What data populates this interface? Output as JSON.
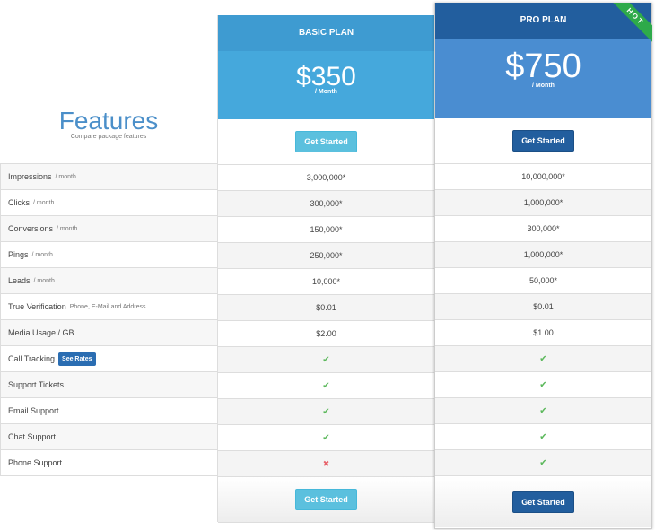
{
  "features_header": {
    "title": "Features",
    "subtitle": "Compare package features"
  },
  "features": [
    {
      "label": "Impressions",
      "sub": "/ month"
    },
    {
      "label": "Clicks",
      "sub": "/ month"
    },
    {
      "label": "Conversions",
      "sub": "/ month"
    },
    {
      "label": "Pings",
      "sub": "/ month"
    },
    {
      "label": "Leads",
      "sub": "/ month"
    },
    {
      "label": "True Verification",
      "sub": "Phone, E-Mail and Address"
    },
    {
      "label": "Media Usage / GB",
      "sub": ""
    },
    {
      "label": "Call Tracking",
      "sub": "",
      "badge": "See Rates"
    },
    {
      "label": "Support Tickets",
      "sub": ""
    },
    {
      "label": "Email Support",
      "sub": ""
    },
    {
      "label": "Chat Support",
      "sub": ""
    },
    {
      "label": "Phone Support",
      "sub": ""
    }
  ],
  "plans": {
    "basic": {
      "name": "BASIC PLAN",
      "price": "$350",
      "period": "/ Month",
      "cta_label": "Get Started",
      "accent": "#45a8dc",
      "values": [
        "3,000,000*",
        "300,000*",
        "150,000*",
        "250,000*",
        "10,000*",
        "$0.01",
        "$2.00",
        "check",
        "check",
        "check",
        "check",
        "cross"
      ]
    },
    "pro": {
      "name": "PRO PLAN",
      "price": "$750",
      "period": "/ Month",
      "cta_label": "Get Started",
      "ribbon": "HOT",
      "accent": "#225e9e",
      "values": [
        "10,000,000*",
        "1,000,000*",
        "300,000*",
        "1,000,000*",
        "50,000*",
        "$0.01",
        "$1.00",
        "check",
        "check",
        "check",
        "check",
        "check"
      ]
    }
  },
  "icons": {
    "included": "check-icon",
    "excluded": "cross-icon"
  }
}
